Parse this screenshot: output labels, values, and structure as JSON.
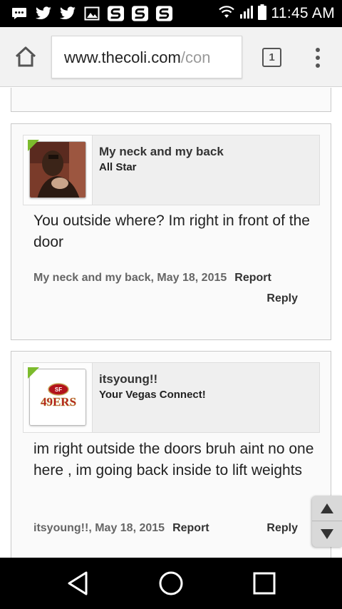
{
  "status_bar": {
    "time": "11:45 AM",
    "notification_icons": [
      "messenger-icon",
      "twitter-icon",
      "twitter-icon",
      "gallery-icon",
      "s-app-icon",
      "s-app-icon",
      "s-app-icon"
    ]
  },
  "browser": {
    "url_domain": "www.thecoli.com",
    "url_path": "/con",
    "tab_count": "1"
  },
  "posts": [
    {
      "username": "My neck and my back",
      "user_title": "All Star",
      "message": "You outside where? Im right in front of the door",
      "meta_author_date": "My neck and my back, May 18, 2015",
      "report_label": "Report",
      "reply_label": "Reply"
    },
    {
      "username": "itsyoung!!",
      "user_title": "Your Vegas Connect!",
      "avatar_logo_text": "49ERS",
      "message": "im right outside the doors bruh aint no one here , im going back inside to lift weights",
      "meta_author_date": "itsyoung!!, May 18, 2015",
      "report_label": "Report",
      "reply_label": "Reply"
    }
  ],
  "colors": {
    "status_bar_bg": "#000000",
    "browser_bar_bg": "#f2f2f2",
    "avatar_corner_accent": "#7cbb2d",
    "niners_red": "#b3131b",
    "niners_gold": "#c7a65a"
  }
}
